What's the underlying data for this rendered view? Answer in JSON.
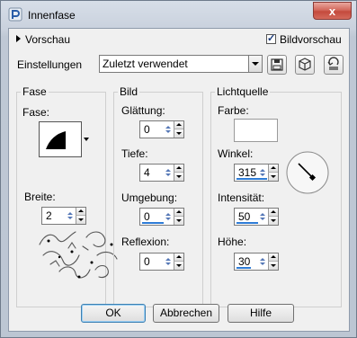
{
  "window": {
    "title": "Innenfase",
    "close_glyph": "x",
    "app_icon": "paint-shop-pro-icon"
  },
  "top": {
    "preview_label": "Vorschau",
    "image_preview_label": "Bildvorschau",
    "image_preview_checked": true
  },
  "settings": {
    "label": "Einstellungen",
    "selected": "Zuletzt verwendet",
    "buttons": [
      "save-icon",
      "3d-cube-icon",
      "reset-icon"
    ]
  },
  "fase_group": {
    "title": "Fase",
    "shape_label": "Fase:",
    "width_label": "Breite:",
    "width_value": "2"
  },
  "bild_group": {
    "title": "Bild",
    "smoothing_label": "Glättung:",
    "smoothing_value": "0",
    "depth_label": "Tiefe:",
    "depth_value": "4",
    "ambient_label": "Umgebung:",
    "ambient_value": "0",
    "reflection_label": "Reflexion:",
    "reflection_value": "0"
  },
  "light_group": {
    "title": "Lichtquelle",
    "color_label": "Farbe:",
    "color_value": "#ffffff",
    "angle_label": "Winkel:",
    "angle_value": "315",
    "intensity_label": "Intensität:",
    "intensity_value": "50",
    "height_label": "Höhe:",
    "height_value": "30"
  },
  "footer": {
    "ok": "OK",
    "cancel": "Abbrechen",
    "help": "Hilfe"
  }
}
